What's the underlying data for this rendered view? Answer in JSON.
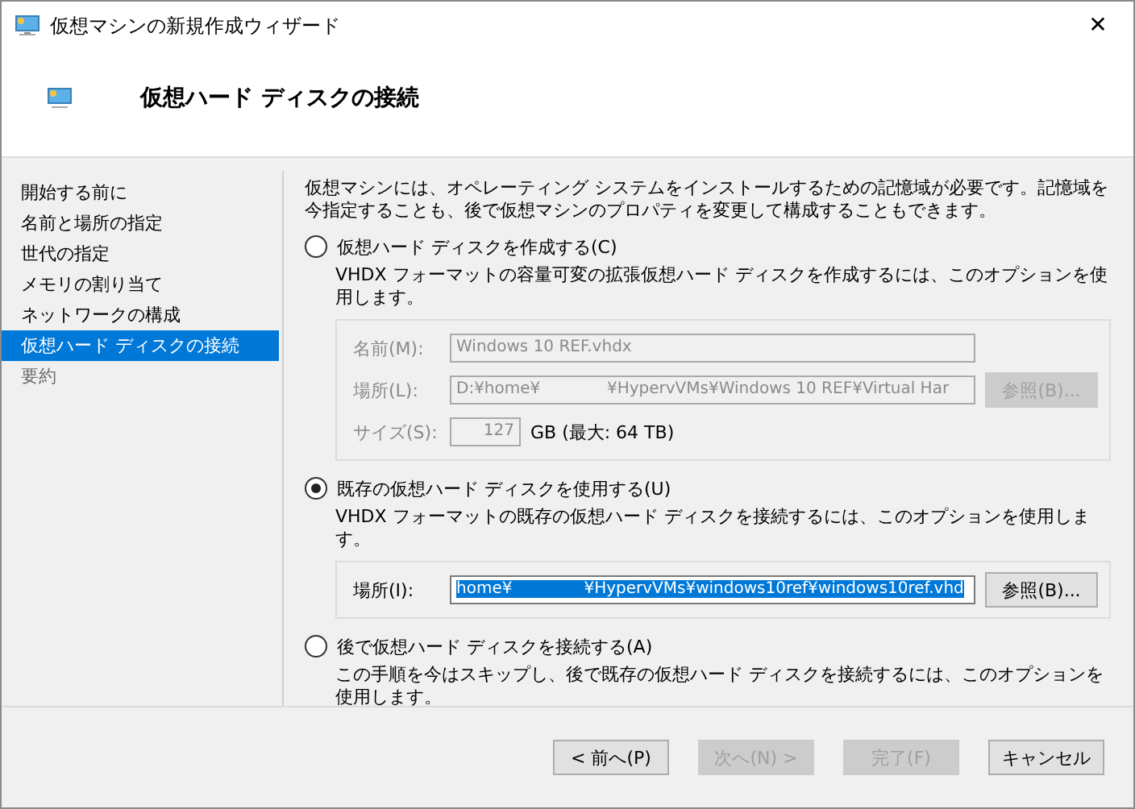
{
  "window": {
    "title": "仮想マシンの新規作成ウィザード",
    "close": "✕"
  },
  "header": {
    "title": "仮想ハード ディスクの接続"
  },
  "steps": [
    {
      "label": "開始する前に",
      "selected": false,
      "disabled": false
    },
    {
      "label": "名前と場所の指定",
      "selected": false,
      "disabled": false
    },
    {
      "label": "世代の指定",
      "selected": false,
      "disabled": false
    },
    {
      "label": "メモリの割り当て",
      "selected": false,
      "disabled": false
    },
    {
      "label": "ネットワークの構成",
      "selected": false,
      "disabled": false
    },
    {
      "label": "仮想ハード ディスクの接続",
      "selected": true,
      "disabled": false
    },
    {
      "label": "要約",
      "selected": false,
      "disabled": true
    }
  ],
  "intro": "仮想マシンには、オペレーティング システムをインストールするための記憶域が必要です。記憶域を今指定することも、後で仮想マシンのプロパティを変更して構成することもできます。",
  "options": [
    {
      "label": "仮想ハード ディスクを作成する(C)",
      "selected": false,
      "description": "VHDX フォーマットの容量可変の拡張仮想ハード ディスクを作成するには、このオプションを使用します。",
      "fields": [
        {
          "kind": "text",
          "label": "名前(M):",
          "value": "Windows 10 REF.vhdx",
          "highlighted": false,
          "disabled": true
        },
        {
          "kind": "path",
          "label": "場所(L):",
          "value": "D:¥home¥             ¥HypervVMs¥Windows 10 REF¥Virtual Har",
          "button": "参照(B)...",
          "highlighted": false,
          "disabled": true
        },
        {
          "kind": "size",
          "label": "サイズ(S):",
          "value": "127",
          "unit": "GB (最大: 64 TB)",
          "highlighted": false,
          "disabled": true
        }
      ]
    },
    {
      "label": "既存の仮想ハード ディスクを使用する(U)",
      "selected": true,
      "description": "VHDX フォーマットの既存の仮想ハード ディスクを接続するには、このオプションを使用します。",
      "fields": [
        {
          "kind": "path",
          "label": "場所(I):",
          "value": "home¥              ¥HypervVMs¥windows10ref¥windows10ref.vhd",
          "button": "参照(B)...",
          "highlighted": true,
          "disabled": false
        }
      ]
    },
    {
      "label": "後で仮想ハード ディスクを接続する(A)",
      "selected": false,
      "description": "この手順を今はスキップし、後で既存の仮想ハード ディスクを接続するには、このオプションを使用します。"
    }
  ],
  "buttons": [
    {
      "label": "< 前へ(P)",
      "disabled": false
    },
    {
      "label": "次へ(N) >",
      "disabled": true
    },
    {
      "label": "完了(F)",
      "disabled": true
    },
    {
      "label": "キャンセル",
      "disabled": false
    }
  ]
}
